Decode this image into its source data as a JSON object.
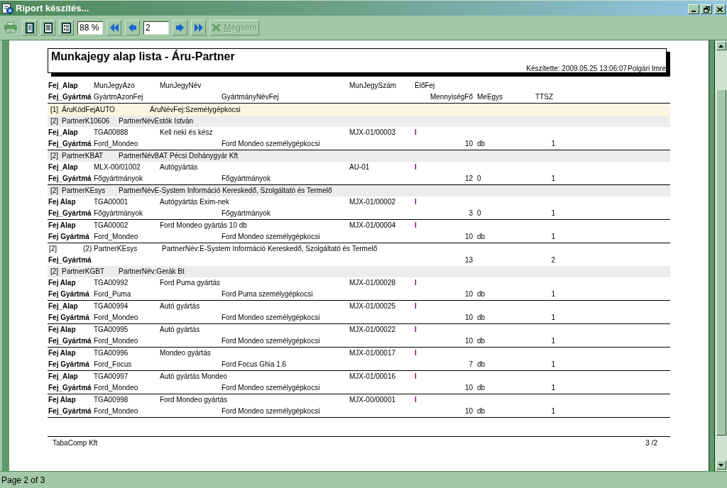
{
  "window": {
    "title": "Riport készítés..."
  },
  "toolbar": [
    {
      "kind": "print",
      "disabled": true
    },
    {
      "kind": "single",
      "disabled": false
    },
    {
      "kind": "lines",
      "disabled": false
    },
    {
      "kind": "columns",
      "disabled": false
    },
    {
      "kind": "zoom",
      "value": "88 %",
      "disabled": false
    },
    {
      "kind": "first",
      "disabled": false
    },
    {
      "kind": "previous",
      "disabled": false
    },
    {
      "kind": "page_number",
      "value": "2",
      "disabled": false
    },
    {
      "kind": "next",
      "disabled": false
    },
    {
      "kind": "last",
      "disabled": false
    },
    {
      "kind": "cancel",
      "label": "Mégsem",
      "disabled": true
    }
  ],
  "report": {
    "title": "Munkajegy alap lista - Áru-Partner",
    "created": "Készítette: 2009.05.25 13:06:07",
    "author": "Polgári Imre",
    "header": [
      {
        "label": "Fej_Alap",
        "cells": [
          "MunJegyAzo",
          "MunJegyNév",
          "MunJegySzám",
          "ÉlőFej"
        ]
      },
      {
        "label": "Fej_Gyártmá",
        "cells": [
          "GyártmAzonFej",
          "GyártmányNévFej",
          "MennyiségFő",
          "MeEgys",
          "TTSZ"
        ]
      }
    ],
    "rows": [
      {
        "kind": "product_group",
        "index": "[1]",
        "code": "ÁruKódFejAUTO",
        "name": "ÁruNévFej:Személygépkocsi"
      },
      {
        "kind": "partner_group",
        "index": "[2]",
        "code": "PartnerK10606",
        "name": "PartnerNévEstók István"
      },
      {
        "kind": "record",
        "alap": {
          "label": "Fej_Alap",
          "id": "TGA00888",
          "name": "Kell neki és kész",
          "number": "MJX-01/00003",
          "flag": "I"
        },
        "gyartmany": {
          "label": "Fej_Gyártmá",
          "id": "Ford_Mondeo",
          "name": "Ford Mondeo személygépkocsi",
          "quantity": "10",
          "unit": "db",
          "ttsz": "1"
        }
      },
      {
        "kind": "partner_group",
        "index": "[2]",
        "code": "PartnerKBAT",
        "name": "PartnerNévBAT Pécsi Dohánygyár Kft"
      },
      {
        "kind": "record",
        "alap": {
          "label": "Fej_Alap",
          "id": "MLX-00/01002",
          "name": "Autógyártás",
          "number": "AU-01",
          "flag": "I"
        },
        "gyartmany": {
          "label": "Fej_Gyártmá",
          "id": "Főgyártmányok",
          "name": "Főgyártmányok",
          "quantity": "12",
          "unit": "0",
          "ttsz": "1"
        }
      },
      {
        "kind": "partner_group",
        "index": "[2]",
        "code": "PartnerKEsys",
        "name": "PartnerNévE-System Információ Kereskedő, Szolgáltató és Termelő"
      },
      {
        "kind": "record",
        "alap": {
          "label": "Fej Alap",
          "id": "TGA00001",
          "name": "Autógyártás Exim-nek",
          "number": "MJX-01/00002",
          "flag": "I"
        },
        "gyartmany": {
          "label": "Fej_Gyártmá",
          "id": "Főgyártmányok",
          "name": "Főgyártmányok",
          "quantity": "3",
          "unit": "0",
          "ttsz": "1"
        }
      },
      {
        "kind": "record",
        "alap": {
          "label": "Fej Alap",
          "id": "TGA00002",
          "name": "Ford Mondeo gyártás 10 db",
          "number": "MJX-01/00004",
          "flag": "I"
        },
        "gyartmany": {
          "label": "Fej Gyártmá",
          "id": "Ford_Mondeo",
          "name": "Ford Mondeo személygépkocsi",
          "quantity": "10",
          "unit": "db",
          "ttsz": "1"
        }
      },
      {
        "kind": "summary",
        "index": "[2]",
        "code": "(2) PartnerKEsys",
        "name": "PartnerNév:E-System Információ Kereskedő, Szolgáltató és Termelő",
        "label": "Fej_Gyártmá",
        "quantity": "13",
        "ttsz": "2"
      },
      {
        "kind": "partner_group",
        "index": "[2]",
        "code": "PartnerKGBT",
        "name": "PartnerNév:Gerák Bt"
      },
      {
        "kind": "record",
        "alap": {
          "label": "Fej Alap",
          "id": "TGA00992",
          "name": "Ford Puma gyártás",
          "number": "MJX-01/00028",
          "flag": "I"
        },
        "gyartmany": {
          "label": "Fej Gyártmá",
          "id": "Ford_Puma",
          "name": "Ford Puma személygépkocsi",
          "quantity": "10",
          "unit": "db",
          "ttsz": "1"
        }
      },
      {
        "kind": "record",
        "alap": {
          "label": "Fej_Alap",
          "id": "TGA00994",
          "name": "Autó gyártás",
          "number": "MJX-01/00025",
          "flag": "I"
        },
        "gyartmany": {
          "label": "Fej Gyártmá",
          "id": "Ford_Mondeo",
          "name": "Ford Mondeo személygépkocsi",
          "quantity": "10",
          "unit": "db",
          "ttsz": "1"
        }
      },
      {
        "kind": "record",
        "alap": {
          "label": "Fej Alap",
          "id": "TGA00995",
          "name": "Autó gyártás",
          "number": "MJX-01/00022",
          "flag": "I"
        },
        "gyartmany": {
          "label": "Fej_Gyártmá",
          "id": "Ford_Mondeo",
          "name": "Ford Mondeo személygépkocsi",
          "quantity": "10",
          "unit": "db",
          "ttsz": "1"
        }
      },
      {
        "kind": "record",
        "alap": {
          "label": "Fej Alap",
          "id": "TGA00996",
          "name": "Mondeo gyártás",
          "number": "MJX-01/00017",
          "flag": "I"
        },
        "gyartmany": {
          "label": "Fej Gyártmá",
          "id": "Ford_Focus",
          "name": "Ford Focus Ghia 1.6",
          "quantity": "7",
          "unit": "db",
          "ttsz": "1"
        }
      },
      {
        "kind": "record",
        "alap": {
          "label": "Fej_Alap",
          "id": "TGA00997",
          "name": "Autó gyártás Mondeo",
          "number": "MJX-01/00016",
          "flag": "I"
        },
        "gyartmany": {
          "label": "Fej_Gyártmá",
          "id": "Ford_Mondeo",
          "name": "Ford Mondeo személygépkocsi",
          "quantity": "10",
          "unit": "db",
          "ttsz": "1"
        }
      },
      {
        "kind": "record",
        "alap": {
          "label": "Fej Alap",
          "id": "TGA00998",
          "name": "Ford Mondeo gyártás",
          "number": "MJX-00/00001",
          "flag": "I"
        },
        "gyartmany": {
          "label": "Fej_Gyártmá",
          "id": "Ford_Mondeo",
          "name": "Ford Mondeo személygépkocsi",
          "quantity": "10",
          "unit": "db",
          "ttsz": "1"
        }
      }
    ],
    "footer": {
      "company": "TabaComp Kft",
      "page": "3 /2"
    }
  },
  "status_bar": {
    "text": "Page 2 of 3"
  }
}
